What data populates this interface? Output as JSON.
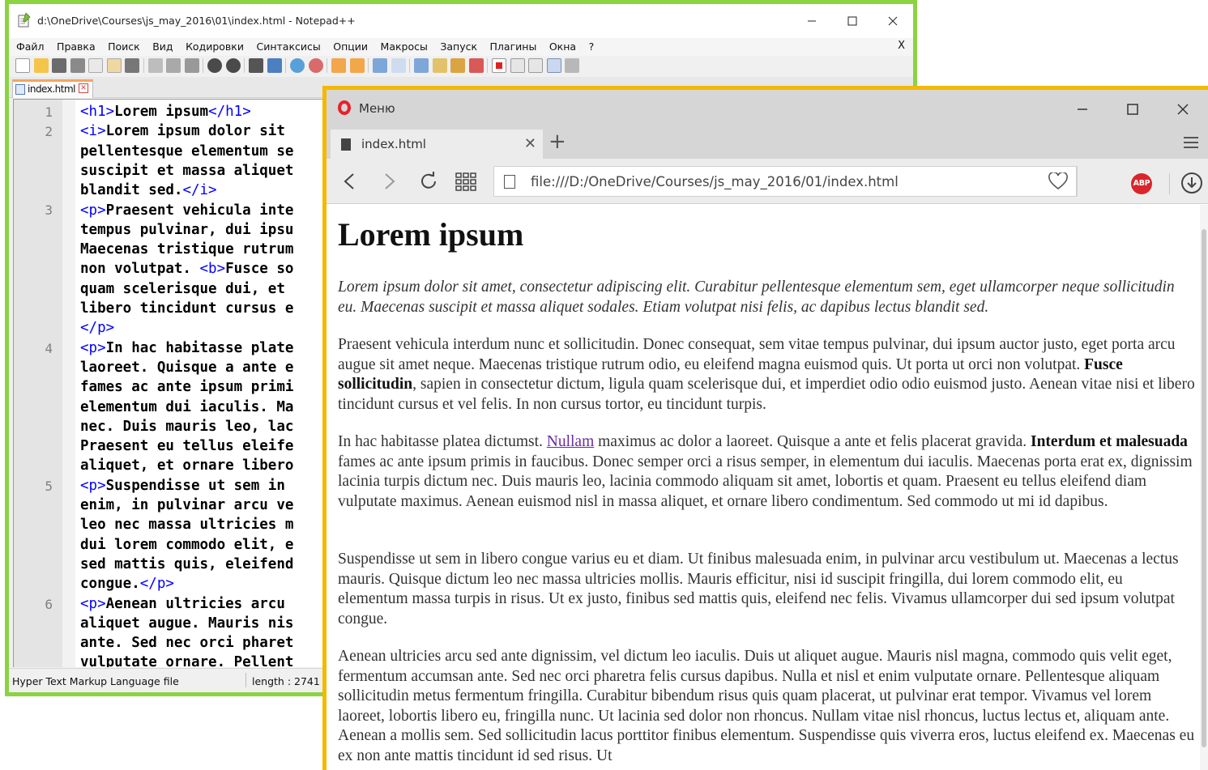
{
  "notepad": {
    "title": "d:\\OneDrive\\Courses\\js_may_2016\\01\\index.html - Notepad++",
    "menu": [
      "Файл",
      "Правка",
      "Поиск",
      "Вид",
      "Кодировки",
      "Синтаксисы",
      "Опции",
      "Макросы",
      "Запуск",
      "Плагины",
      "Окна",
      "?"
    ],
    "menu_close": "X",
    "tab_label": "index.html",
    "tab_close": "✕",
    "line_numbers": [
      "1",
      "2",
      "3",
      "4",
      "5",
      "6"
    ],
    "code": {
      "l1_open": "<h1>",
      "l1_text": "Lorem ipsum",
      "l1_close": "</h1>",
      "l2_open": "<i>",
      "l2_text": "Lorem ipsum dolor sit",
      "l2b": "pellentesque elementum se",
      "l2c": "suscipit et massa aliquet",
      "l2d_text": "blandit sed.",
      "l2d_close": "</i>",
      "l3_open": "<p>",
      "l3_text": "Praesent vehicula inte",
      "l3b": "tempus pulvinar, dui ipsu",
      "l3c": "Maecenas tristique rutrum",
      "l3d_text": "non volutpat. ",
      "l3d_tag": "<b>",
      "l3d_text2": "Fusce so",
      "l3e": "quam scelerisque dui, et",
      "l3f": "libero tincidunt cursus e",
      "l3g_close": "</p>",
      "l4_open": "<p>",
      "l4_text": "In hac habitasse plate",
      "l4b": "laoreet. Quisque a ante e",
      "l4c": "fames ac ante ipsum primi",
      "l4d": "elementum dui iaculis. Ma",
      "l4e": "nec. Duis mauris leo, lac",
      "l4f": "Praesent eu tellus eleife",
      "l4g": "aliquet, et ornare libero",
      "l5_open": "<p>",
      "l5_text": "Suspendisse ut sem in",
      "l5b": "enim, in pulvinar arcu ve",
      "l5c": "leo nec massa ultricies m",
      "l5d": "dui lorem commodo elit, e",
      "l5e": "sed mattis quis, eleifend",
      "l5f_text": "congue.",
      "l5f_close": "</p>",
      "l6_open": "<p>",
      "l6_text": "Aenean ultricies arcu",
      "l6b": "aliquet augue. Mauris nis",
      "l6c": "ante. Sed nec orci pharet",
      "l6d": "vulputate ornare. Pellent"
    },
    "status_type": "Hyper Text Markup Language file",
    "status_length": "length : 2741"
  },
  "opera": {
    "menu_label": "Меню",
    "tab_label": "index.html",
    "tab_close": "✕",
    "new_tab": "+",
    "url": "file:///D:/OneDrive/Courses/js_may_2016/01/index.html",
    "abp_label": "ABP",
    "page": {
      "h1": "Lorem ipsum",
      "p1": "Lorem ipsum dolor sit amet, consectetur adipiscing elit. Curabitur pellentesque elementum sem, eget ullamcorper neque sollicitudin eu. Maecenas suscipit et massa aliquet sodales. Etiam volutpat nisi felis, ac dapibus lectus blandit sed.",
      "p2_a": "Praesent vehicula interdum nunc et sollicitudin. Donec consequat, sem vitae tempus pulvinar, dui ipsum auctor justo, eget porta arcu augue sit amet neque. Maecenas tristique rutrum odio, eu eleifend magna euismod quis. Ut porta ut orci non volutpat. ",
      "p2_bold": "Fusce sollicitudin",
      "p2_b": ", sapien in consectetur dictum, ligula quam scelerisque dui, et imperdiet odio odio euismod justo. Aenean vitae nisi et libero tincidunt cursus et vel felis. In non cursus tortor, eu tincidunt turpis.",
      "p3_a": "In hac habitasse platea dictumst. ",
      "p3_link": "Nullam",
      "p3_b": " maximus ac dolor a laoreet. Quisque a ante et felis placerat gravida. ",
      "p3_bold": "Interdum et malesuada",
      "p3_c": " fames ac ante ipsum primis in faucibus. Donec semper orci a risus semper, in elementum dui iaculis. Maecenas porta erat ex, dignissim lacinia turpis dictum nec. Duis mauris leo, lacinia commodo aliquam sit amet, lobortis et quam. Praesent eu tellus eleifend diam vulputate maximus. Aenean euismod nisl in massa aliquet, et ornare libero condimentum. Sed commodo ut mi id dapibus.",
      "p4": "Suspendisse ut sem in libero congue varius eu et diam. Ut finibus malesuada enim, in pulvinar arcu vestibulum ut. Maecenas a lectus mauris. Quisque dictum leo nec massa ultricies mollis. Mauris efficitur, nisi id suscipit fringilla, dui lorem commodo elit, eu elementum massa turpis in risus. Ut ex justo, finibus sed mattis quis, eleifend nec felis. Vivamus ullamcorper dui sed ipsum volutpat congue.",
      "p5": "Aenean ultricies arcu sed ante dignissim, vel dictum leo iaculis. Duis ut aliquet augue. Mauris nisl magna, commodo quis velit eget, fermentum accumsan ante. Sed nec orci pharetra felis cursus dapibus. Nulla et nisl et enim vulputate ornare. Pellentesque aliquam sollicitudin metus fermentum fringilla. Curabitur bibendum risus quis quam placerat, ut pulvinar erat tempor. Vivamus vel lorem laoreet, lobortis libero eu, fringilla nunc. Ut lacinia sed dolor non rhoncus. Nullam vitae nisl rhoncus, luctus lectus et, aliquam ante. Aenean a mollis sem. Sed sollicitudin lacus porttitor finibus elementum. Suspendisse quis viverra eros, luctus eleifend ex. Maecenas eu ex non ante mattis tincidunt id sed risus. Ut"
    }
  },
  "colors": {
    "notepad_border": "#8bd341",
    "opera_border": "#f5b800",
    "html_tag": "#0000ff",
    "link": "#6a2aa3",
    "opera_logo": "#e8202b",
    "abp": "#d8262b"
  },
  "icons": [
    "notepad-icon",
    "minimize-icon",
    "maximize-icon",
    "close-icon",
    "opera-logo-icon",
    "document-icon",
    "back-icon",
    "forward-icon",
    "reload-icon",
    "speed-dial-icon",
    "file-icon",
    "heart-icon",
    "adblock-icon",
    "download-icon",
    "menu-icon"
  ]
}
